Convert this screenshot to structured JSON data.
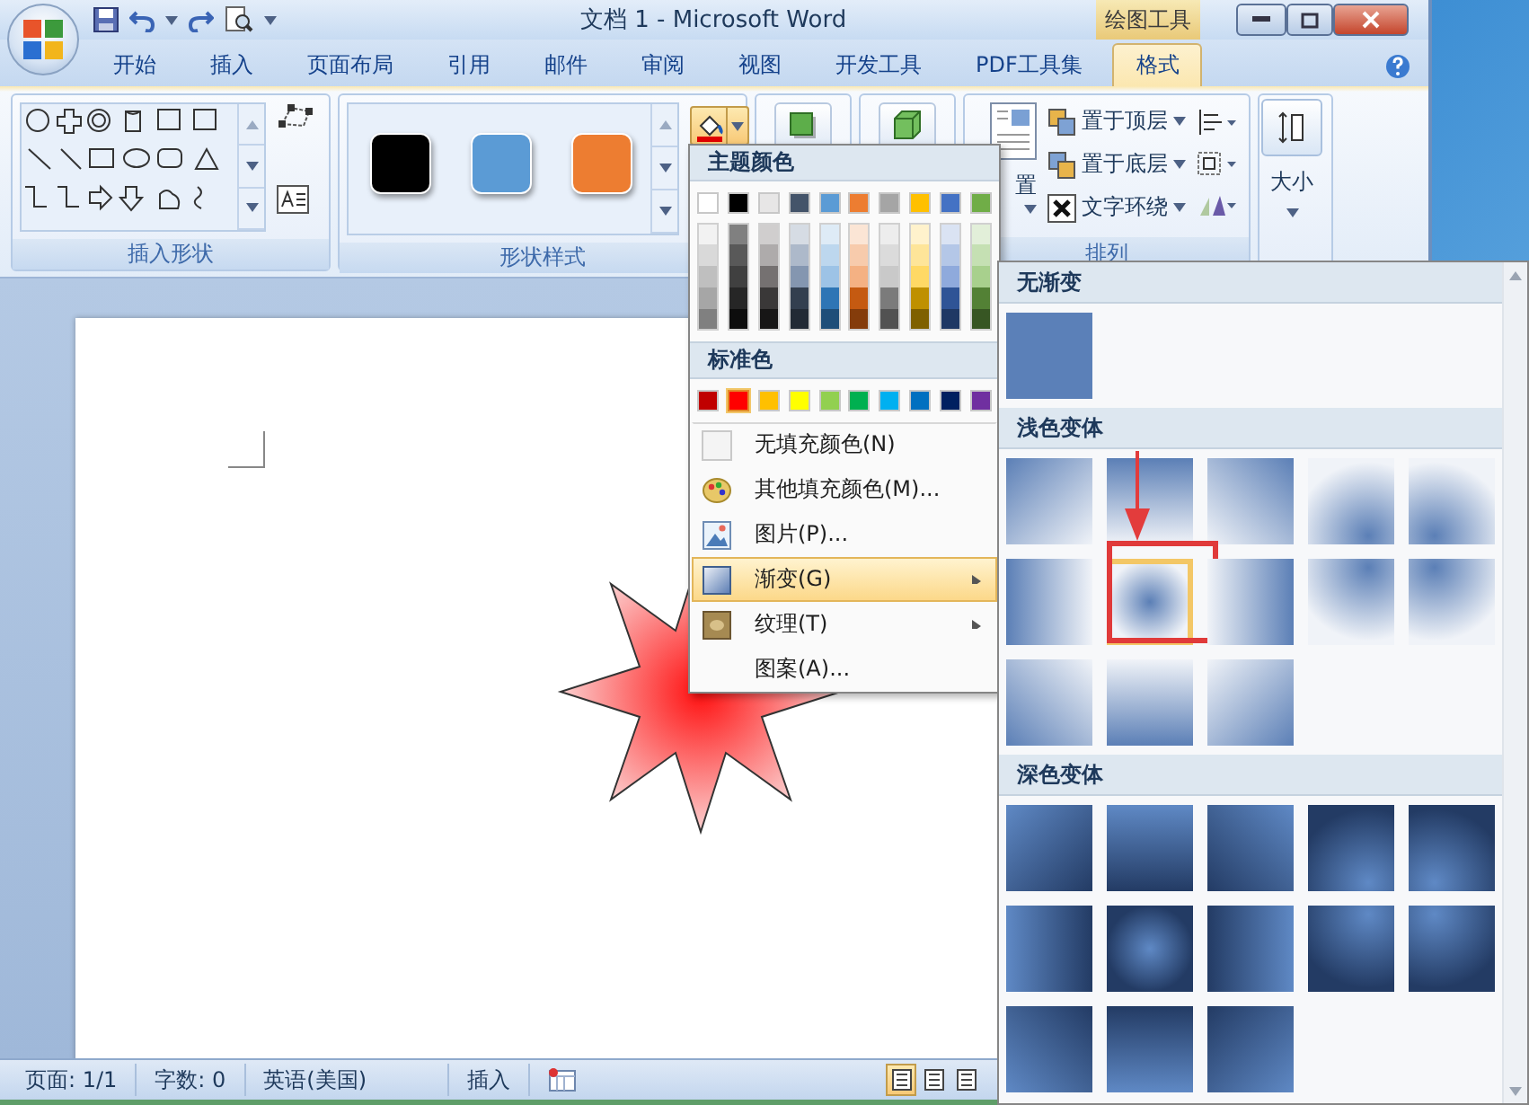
{
  "window": {
    "title": "文档 1 - Microsoft Word",
    "context_label": "绘图工具"
  },
  "ribbon_tabs": [
    {
      "label": "开始",
      "selected": false
    },
    {
      "label": "插入",
      "selected": false
    },
    {
      "label": "页面布局",
      "selected": false
    },
    {
      "label": "引用",
      "selected": false
    },
    {
      "label": "邮件",
      "selected": false
    },
    {
      "label": "审阅",
      "selected": false
    },
    {
      "label": "视图",
      "selected": false
    },
    {
      "label": "开发工具",
      "selected": false
    },
    {
      "label": "PDF工具集",
      "selected": false
    },
    {
      "label": "格式",
      "selected": true
    }
  ],
  "ribbon_groups": [
    {
      "kind": "shapes",
      "label": "插入形状"
    },
    {
      "kind": "styles",
      "label": "形状样式",
      "fill_button_open": true,
      "swatches": [
        {
          "color": "#000000"
        },
        {
          "color": "#5b9bd5"
        },
        {
          "color": "#ed7d31"
        }
      ]
    },
    {
      "kind": "shadow"
    },
    {
      "kind": "three-d"
    },
    {
      "kind": "arrange",
      "label": "排列",
      "position_label": "置",
      "commands": [
        "置于顶层",
        "置于底层",
        "文字环绕"
      ]
    },
    {
      "kind": "size",
      "button_label": "大小"
    }
  ],
  "fill_menu": {
    "theme_heading": "主题颜色",
    "theme_columns": [
      {
        "color": "#ffffff",
        "shades": [
          {
            "color": "#f2f2f2"
          },
          {
            "color": "#d9d9d9"
          },
          {
            "color": "#bfbfbf"
          },
          {
            "color": "#a6a6a6"
          },
          {
            "color": "#808080"
          }
        ]
      },
      {
        "color": "#000000",
        "shades": [
          {
            "color": "#808080"
          },
          {
            "color": "#595959"
          },
          {
            "color": "#404040"
          },
          {
            "color": "#262626"
          },
          {
            "color": "#0d0d0d"
          }
        ]
      },
      {
        "color": "#e7e6e6",
        "shades": [
          {
            "color": "#d0cece"
          },
          {
            "color": "#aeabab"
          },
          {
            "color": "#757171"
          },
          {
            "color": "#3a3838"
          },
          {
            "color": "#171616"
          }
        ]
      },
      {
        "color": "#44546a",
        "shades": [
          {
            "color": "#d6dce4"
          },
          {
            "color": "#adb9ca"
          },
          {
            "color": "#8496b0"
          },
          {
            "color": "#333f4f"
          },
          {
            "color": "#222a35"
          }
        ]
      },
      {
        "color": "#5b9bd5",
        "shades": [
          {
            "color": "#deebf6"
          },
          {
            "color": "#bdd7ee"
          },
          {
            "color": "#9dc3e6"
          },
          {
            "color": "#2e75b5"
          },
          {
            "color": "#1f4e79"
          }
        ]
      },
      {
        "color": "#ed7d31",
        "shades": [
          {
            "color": "#fbe5d5"
          },
          {
            "color": "#f7cbac"
          },
          {
            "color": "#f4b183"
          },
          {
            "color": "#c55a11"
          },
          {
            "color": "#843c0b"
          }
        ]
      },
      {
        "color": "#a5a5a5",
        "shades": [
          {
            "color": "#ededed"
          },
          {
            "color": "#dbdbdb"
          },
          {
            "color": "#c9c9c9"
          },
          {
            "color": "#7b7b7b"
          },
          {
            "color": "#525252"
          }
        ]
      },
      {
        "color": "#ffc000",
        "shades": [
          {
            "color": "#fff2cc"
          },
          {
            "color": "#fee599"
          },
          {
            "color": "#ffd965"
          },
          {
            "color": "#bf9000"
          },
          {
            "color": "#7f6000"
          }
        ]
      },
      {
        "color": "#4472c4",
        "shades": [
          {
            "color": "#dae3f3"
          },
          {
            "color": "#b4c7e7"
          },
          {
            "color": "#8faadc"
          },
          {
            "color": "#2f5496"
          },
          {
            "color": "#1f3864"
          }
        ]
      },
      {
        "color": "#70ad47",
        "shades": [
          {
            "color": "#e2efd9"
          },
          {
            "color": "#c5e0b3"
          },
          {
            "color": "#a8d08d"
          },
          {
            "color": "#538135"
          },
          {
            "color": "#375623"
          }
        ]
      }
    ],
    "standard_heading": "标准色",
    "standard_colors": [
      {
        "color": "#c00000",
        "selected": false
      },
      {
        "color": "#ff0000",
        "selected": true
      },
      {
        "color": "#ffc000",
        "selected": false
      },
      {
        "color": "#ffff00",
        "selected": false
      },
      {
        "color": "#92d050",
        "selected": false
      },
      {
        "color": "#00b050",
        "selected": false
      },
      {
        "color": "#00b0f0",
        "selected": false
      },
      {
        "color": "#0070c0",
        "selected": false
      },
      {
        "color": "#002060",
        "selected": false
      },
      {
        "color": "#7030a0",
        "selected": false
      }
    ],
    "items": [
      {
        "kind": "no-fill",
        "label": "无填充颜色(N)",
        "highlighted": false,
        "submenu": false
      },
      {
        "kind": "more-colors",
        "label": "其他填充颜色(M)...",
        "highlighted": false,
        "submenu": false
      },
      {
        "kind": "picture",
        "label": "图片(P)...",
        "highlighted": false,
        "submenu": false
      },
      {
        "kind": "gradient",
        "label": "渐变(G)",
        "highlighted": true,
        "submenu": true
      },
      {
        "kind": "texture",
        "label": "纹理(T)",
        "highlighted": false,
        "submenu": true
      },
      {
        "kind": "pattern",
        "label": "图案(A)...",
        "highlighted": false,
        "submenu": false
      }
    ]
  },
  "gradient_panel": {
    "sections": [
      {
        "heading": "无渐变",
        "kind": "solid",
        "tiles": [
          {
            "kind": "solid",
            "selected": false,
            "annotated": false
          }
        ]
      },
      {
        "heading": "浅色变体",
        "kind": "light",
        "tiles": [
          {
            "kind": "from-top-left",
            "selected": false,
            "annotated": false
          },
          {
            "kind": "from-top",
            "selected": false,
            "annotated": false
          },
          {
            "kind": "from-top-right",
            "selected": false,
            "annotated": false
          },
          {
            "kind": "radial-bottom-right",
            "selected": false,
            "annotated": false
          },
          {
            "kind": "radial-bottom-left",
            "selected": false,
            "annotated": false
          },
          {
            "kind": "from-left",
            "selected": false,
            "annotated": false
          },
          {
            "kind": "from-center",
            "selected": true,
            "annotated": true
          },
          {
            "kind": "from-right",
            "selected": false,
            "annotated": false
          },
          {
            "kind": "radial-top-right",
            "selected": false,
            "annotated": false
          },
          {
            "kind": "radial-top-left",
            "selected": false,
            "annotated": false
          },
          {
            "kind": "from-bottom-left",
            "selected": false,
            "annotated": false
          },
          {
            "kind": "from-bottom",
            "selected": false,
            "annotated": false
          },
          {
            "kind": "from-bottom-right",
            "selected": false,
            "annotated": false
          }
        ]
      },
      {
        "heading": "深色变体",
        "kind": "dark",
        "tiles": [
          {
            "kind": "from-top-left",
            "selected": false,
            "annotated": false
          },
          {
            "kind": "from-top",
            "selected": false,
            "annotated": false
          },
          {
            "kind": "from-top-right",
            "selected": false,
            "annotated": false
          },
          {
            "kind": "radial-bottom-right",
            "selected": false,
            "annotated": false
          },
          {
            "kind": "radial-bottom-left",
            "selected": false,
            "annotated": false
          },
          {
            "kind": "from-left",
            "selected": false,
            "annotated": false
          },
          {
            "kind": "from-center",
            "selected": false,
            "annotated": false
          },
          {
            "kind": "from-right",
            "selected": false,
            "annotated": false
          },
          {
            "kind": "radial-top-right",
            "selected": false,
            "annotated": false
          },
          {
            "kind": "radial-top-left",
            "selected": false,
            "annotated": false
          },
          {
            "kind": "from-bottom-left",
            "selected": false,
            "annotated": false
          },
          {
            "kind": "from-bottom",
            "selected": false,
            "annotated": false
          },
          {
            "kind": "from-bottom-right",
            "selected": false,
            "annotated": false
          }
        ]
      }
    ]
  },
  "status_bar": {
    "items": [
      "页面: 1/1",
      "字数: 0",
      "英语(美国)",
      "插入"
    ],
    "views": [
      {
        "selected": true
      },
      {
        "selected": false
      },
      {
        "selected": false
      }
    ]
  }
}
